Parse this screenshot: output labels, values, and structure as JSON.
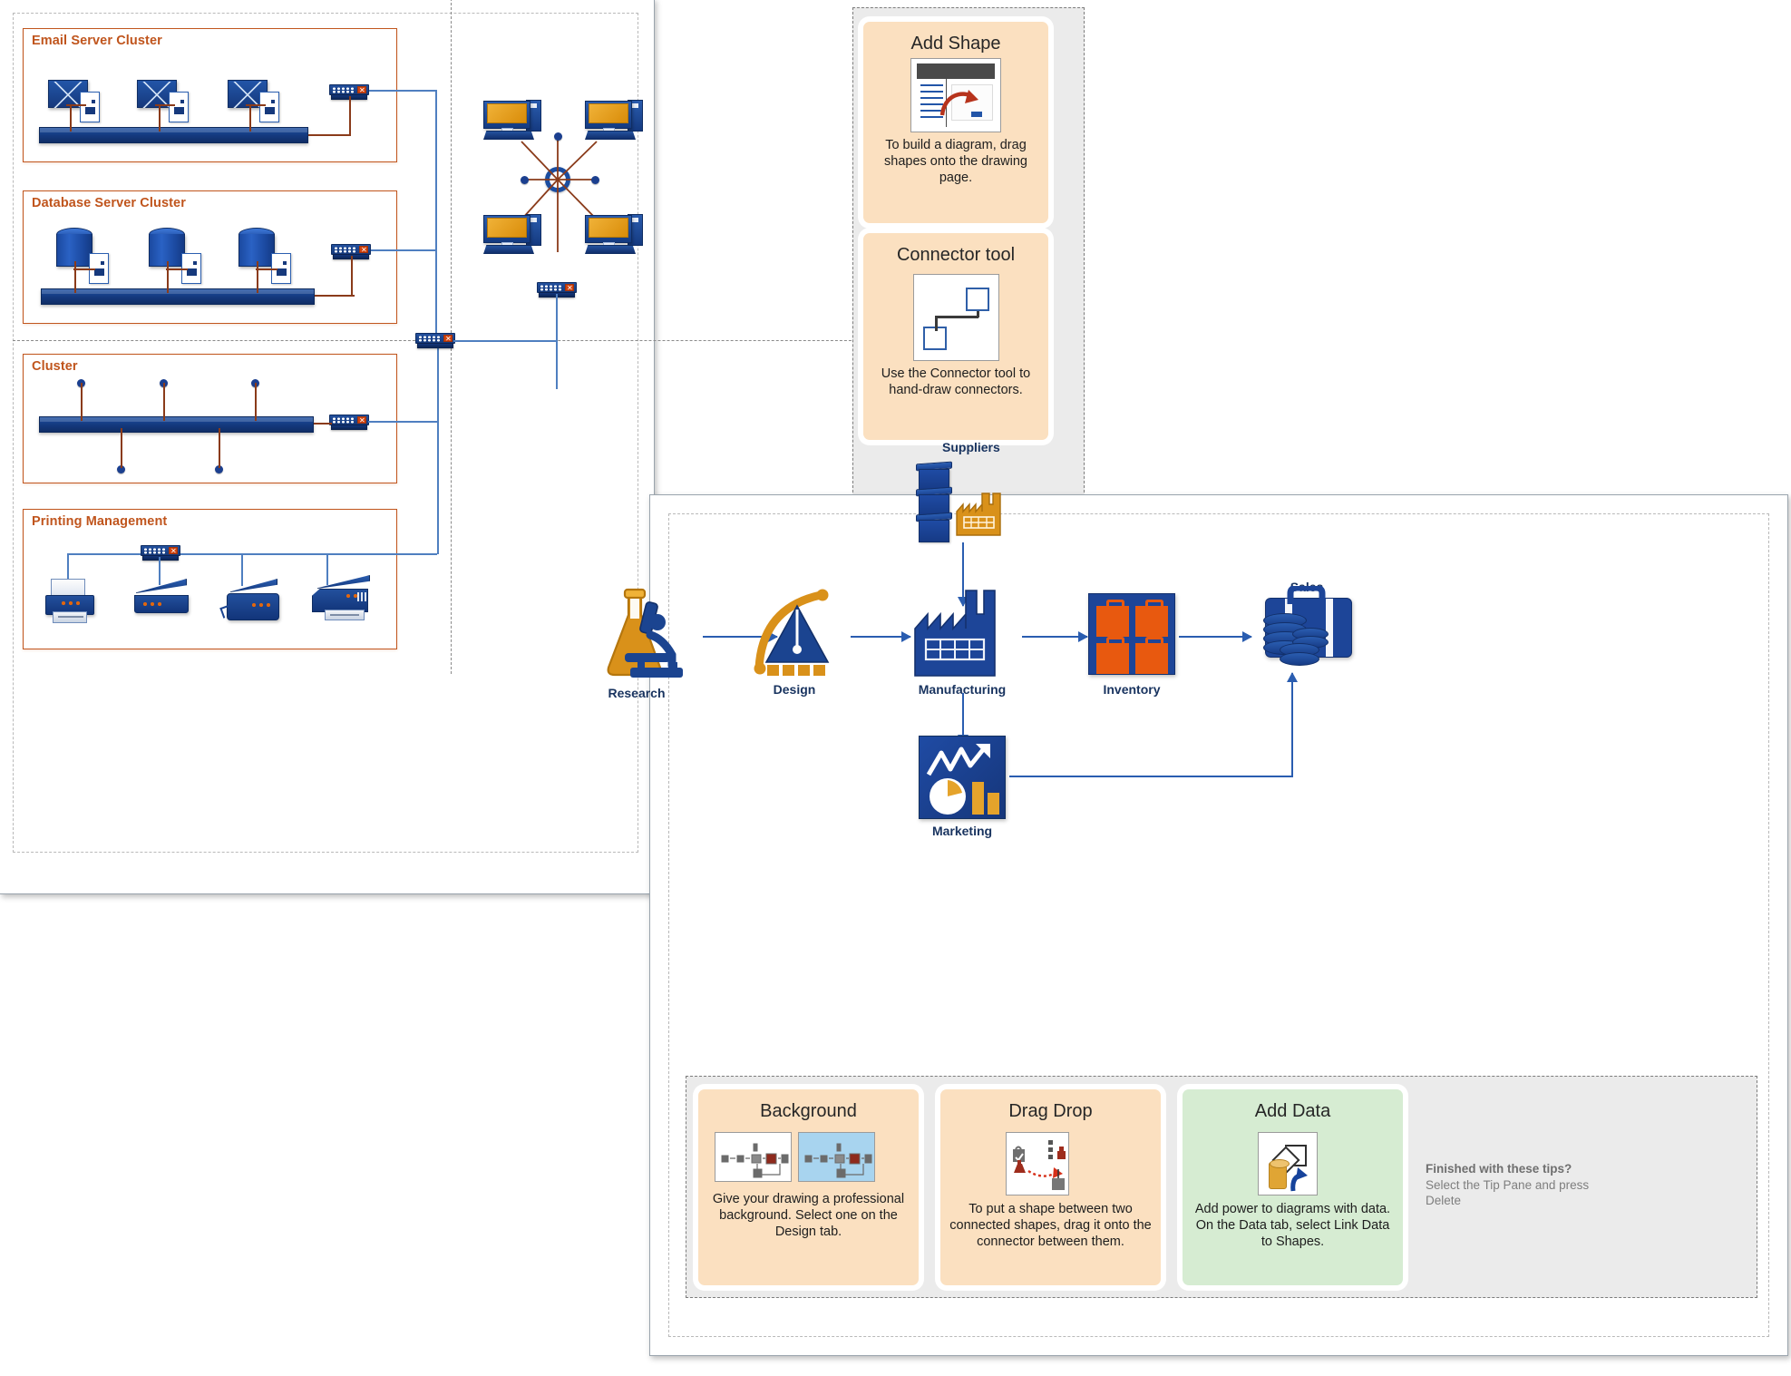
{
  "network_diagram": {
    "clusters": [
      {
        "title": "Email Server Cluster",
        "node_icon": "envelope-icon",
        "node_count": 3
      },
      {
        "title": "Database Server Cluster",
        "node_icon": "database-cylinder-icon",
        "node_count": 3
      },
      {
        "title": "Cluster",
        "node_icon": "endpoint-dot-icon",
        "node_count": 5
      },
      {
        "title": "Printing Management",
        "node_icon": "printer-icon",
        "node_count": 4
      }
    ],
    "colors": {
      "cluster_border": "#c1561e",
      "cluster_title": "#c0551d",
      "device_blue": "#1b4da0",
      "bus_blue": "#14387d",
      "wire_brown": "#8a3b1a",
      "wire_blue": "#4f7fc0",
      "screen_orange": "#d98c09"
    },
    "topology": {
      "center_icon": "hub-ring-icon",
      "workstations": 4,
      "switch_icon": "switch-icon"
    }
  },
  "tip_pane_top": {
    "cards": [
      {
        "title": "Add Shape",
        "body": "To build a diagram, drag shapes onto the drawing page.",
        "thumb_icon": "drag-shape-thumbnail"
      },
      {
        "title": "Connector tool",
        "body": "Use the Connector tool to hand-draw connectors.",
        "thumb_icon": "connector-thumbnail"
      }
    ]
  },
  "tip_pane_bottom": {
    "cards": [
      {
        "title": "Background",
        "body": "Give your drawing a professional background. Select one on the Design tab.",
        "thumb_icon": "background-thumbnail",
        "accent": "#fbe0c0"
      },
      {
        "title": "Drag Drop",
        "body": "To put a shape between two connected shapes, drag it onto the connector between them.",
        "thumb_icon": "drag-drop-thumbnail",
        "accent": "#fbe0c0"
      },
      {
        "title": "Add Data",
        "body": "Add power to diagrams with data. On the Data tab, select Link Data to Shapes.",
        "thumb_icon": "add-data-thumbnail",
        "accent": "#d6ecd2"
      }
    ],
    "finished_heading": "Finished with these tips?",
    "finished_body": "Select the Tip Pane and press Delete"
  },
  "process_diagram": {
    "nodes": [
      {
        "id": "research",
        "label": "Research",
        "icon": "flask-microscope-icon"
      },
      {
        "id": "design",
        "label": "Design",
        "icon": "drafting-compass-icon"
      },
      {
        "id": "suppliers",
        "label": "Suppliers",
        "icon": "bins-factory-icon"
      },
      {
        "id": "manufacturing",
        "label": "Manufacturing",
        "icon": "factory-icon"
      },
      {
        "id": "inventory",
        "label": "Inventory",
        "icon": "inventory-cases-icon"
      },
      {
        "id": "marketing",
        "label": "Marketing",
        "icon": "analytics-chart-icon"
      },
      {
        "id": "sales",
        "label": "Sales",
        "icon": "briefcase-coins-icon"
      }
    ],
    "flows": [
      {
        "from": "research",
        "to": "design"
      },
      {
        "from": "design",
        "to": "manufacturing"
      },
      {
        "from": "suppliers",
        "to": "manufacturing"
      },
      {
        "from": "manufacturing",
        "to": "inventory"
      },
      {
        "from": "inventory",
        "to": "sales"
      },
      {
        "from": "manufacturing",
        "to": "marketing"
      },
      {
        "from": "marketing",
        "to": "sales"
      }
    ],
    "colors": {
      "connector": "#2a5db0",
      "node_blue": "#1d4598",
      "node_orange": "#e8590f",
      "node_gold": "#d98c09"
    }
  }
}
